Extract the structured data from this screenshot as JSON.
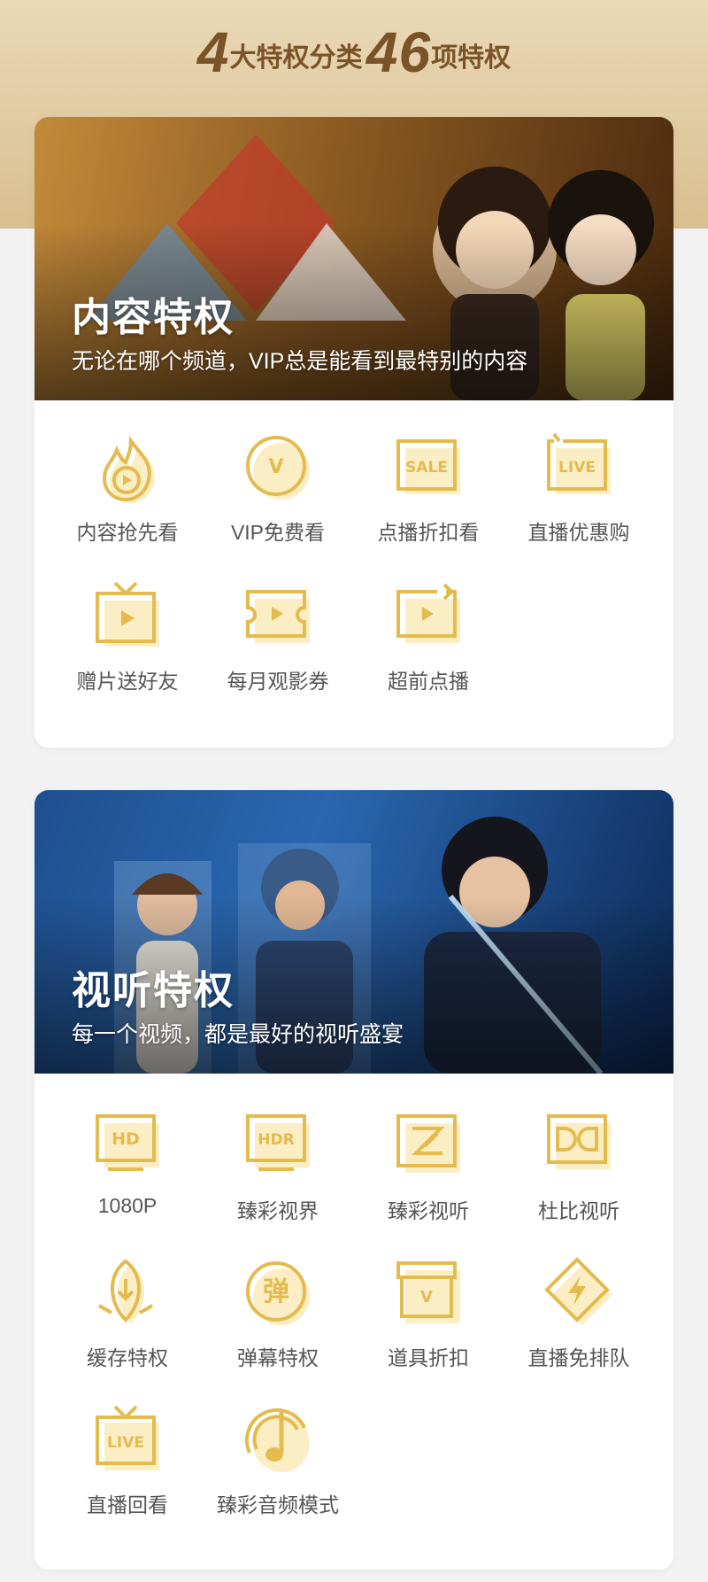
{
  "header": {
    "num_categories": "4",
    "text_categories": "大特权分类",
    "num_privileges": "46",
    "text_privileges": "项特权"
  },
  "colors": {
    "gold": "#e3bb4e",
    "gold_light": "#fbeec4",
    "brown": "#7a5428"
  },
  "sections": [
    {
      "title": "内容特权",
      "subtitle": "无论在哪个频道，VIP总是能看到最特别的内容",
      "items": [
        {
          "label": "内容抢先看",
          "icon": "flame-play-icon"
        },
        {
          "label": "VIP免费看",
          "icon": "vip-circle-icon",
          "glyph": "V"
        },
        {
          "label": "点播折扣看",
          "icon": "sale-tag-icon",
          "glyph": "SALE"
        },
        {
          "label": "直播优惠购",
          "icon": "live-tag-icon",
          "glyph": "LIVE"
        },
        {
          "label": "赠片送好友",
          "icon": "gift-tv-icon"
        },
        {
          "label": "每月观影券",
          "icon": "ticket-icon"
        },
        {
          "label": "超前点播",
          "icon": "advance-play-icon"
        }
      ]
    },
    {
      "title": "视听特权",
      "subtitle": "每一个视频，都是最好的视听盛宴",
      "items": [
        {
          "label": "1080P",
          "icon": "hd-icon",
          "glyph": "HD"
        },
        {
          "label": "臻彩视界",
          "icon": "hdr-icon",
          "glyph": "HDR"
        },
        {
          "label": "臻彩视听",
          "icon": "z-logo-icon"
        },
        {
          "label": "杜比视听",
          "icon": "dolby-icon"
        },
        {
          "label": "缓存特权",
          "icon": "download-leaf-icon"
        },
        {
          "label": "弹幕特权",
          "icon": "danmu-icon",
          "glyph": "弹"
        },
        {
          "label": "道具折扣",
          "icon": "prop-box-icon",
          "glyph": "V"
        },
        {
          "label": "直播免排队",
          "icon": "lightning-diamond-icon"
        },
        {
          "label": "直播回看",
          "icon": "live-replay-icon",
          "glyph": "LIVE"
        },
        {
          "label": "臻彩音频模式",
          "icon": "music-note-icon"
        }
      ]
    }
  ]
}
